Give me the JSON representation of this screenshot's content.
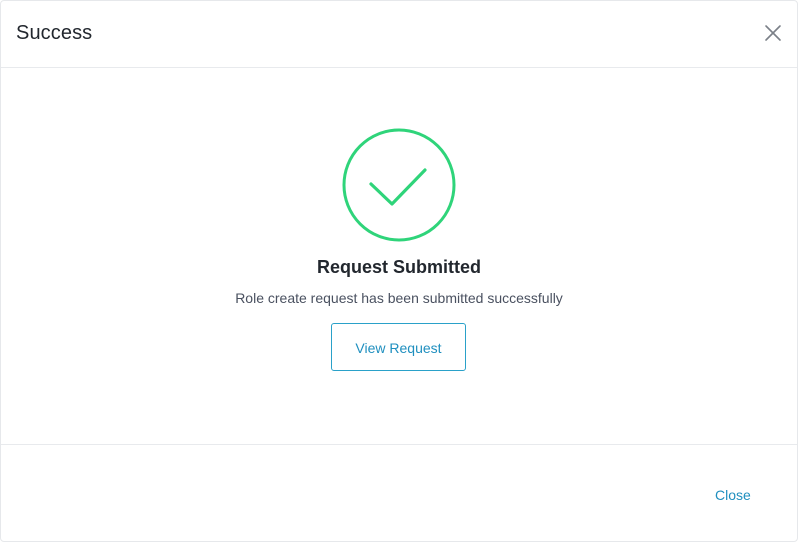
{
  "dialog": {
    "title": "Success",
    "close_icon": "close-icon"
  },
  "status": {
    "icon": "check-circle-icon",
    "accent_color": "#2fd47a",
    "title": "Request Submitted",
    "message": "Role create request has been submitted successfully"
  },
  "actions": {
    "view_request_label": "View Request",
    "close_label": "Close",
    "link_color": "#1f8fbf"
  }
}
